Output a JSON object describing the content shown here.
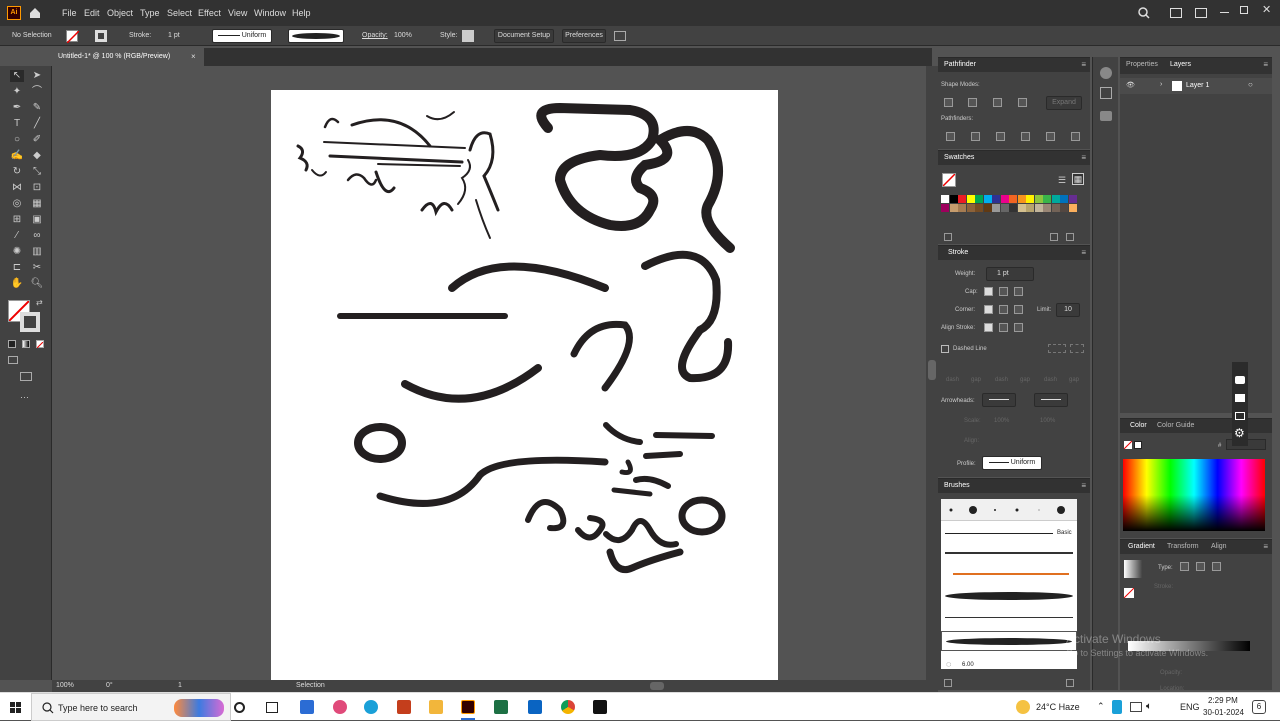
{
  "app": {
    "logo": "Ai"
  },
  "menu": [
    "File",
    "Edit",
    "Object",
    "Type",
    "Select",
    "Effect",
    "View",
    "Window",
    "Help"
  ],
  "control": {
    "selection_label": "No Selection",
    "stroke_label": "Stroke:",
    "stroke_value": "1 pt",
    "uniform_label": "Uniform",
    "opacity_label": "Opacity:",
    "opacity_value": "100%",
    "style_label": "Style:",
    "doc_setup": "Document Setup",
    "preferences": "Preferences"
  },
  "document_tab": {
    "title": "Untitled-1* @ 100 % (RGB/Preview)"
  },
  "status": {
    "zoom": "100%",
    "rotation": "0°",
    "artboard": "1",
    "tool": "Selection"
  },
  "pathfinder": {
    "title": "Pathfinder",
    "shape_modes": "Shape Modes:",
    "expand": "Expand",
    "pathfinders": "Pathfinders:"
  },
  "swatches": {
    "title": "Swatches",
    "colors": [
      "#ffffff",
      "#000000",
      "#ed1c24",
      "#ffff00",
      "#00a651",
      "#00aeef",
      "#2e3192",
      "#ec008c",
      "#f26522",
      "#f7941d",
      "#fff200",
      "#8dc63f",
      "#39b54a",
      "#00a99d",
      "#0072bc",
      "#662d91",
      "#9e005d",
      "#c69c6d",
      "#a67c52",
      "#8c6239",
      "#754c24",
      "#603913",
      "#999999",
      "#666666",
      "#333333",
      "#d4c08f",
      "#b7a46e",
      "#c2b59b",
      "#998675",
      "#736357",
      "#534741",
      "#fbaf5d"
    ]
  },
  "stroke_panel": {
    "title": "Stroke",
    "weight_label": "Weight:",
    "weight_value": "1 pt",
    "cap_label": "Cap:",
    "corner_label": "Corner:",
    "limit_label": "Limit:",
    "limit_value": "10",
    "align_label": "Align Stroke:",
    "dashed_label": "Dashed Line",
    "dash_labels": [
      "dash",
      "gap",
      "dash",
      "gap",
      "dash",
      "gap"
    ],
    "arrowheads_label": "Arrowheads:",
    "scale_label": "Scale:",
    "scale_values": [
      "100%",
      "100%"
    ],
    "align_label2": "Align:",
    "profile_label": "Profile:",
    "profile_value": "Uniform"
  },
  "brushes": {
    "title": "Brushes",
    "basic_label": "Basic",
    "size_value": "6.00"
  },
  "properties_tab": "Properties",
  "layers": {
    "tab": "Layers",
    "layer_name": "Layer 1"
  },
  "color_panel": {
    "tab1": "Color",
    "tab2": "Color Guide",
    "hash": "#"
  },
  "gradient_panel": {
    "tab1": "Gradient",
    "tab2": "Transform",
    "tab3": "Align",
    "type_label": "Type:",
    "stroke_label": "Stroke:",
    "opacity_label": "Opacity:",
    "location_label": "Location:"
  },
  "watermark": {
    "line1": "Activate Windows",
    "line2": "Go to Settings to activate Windows."
  },
  "taskbar": {
    "search_placeholder": "Type here to search",
    "weather": "24°C  Haze",
    "lang": "ENG",
    "time": "2:29 PM",
    "date": "30-01-2024",
    "notification_count": "6"
  }
}
